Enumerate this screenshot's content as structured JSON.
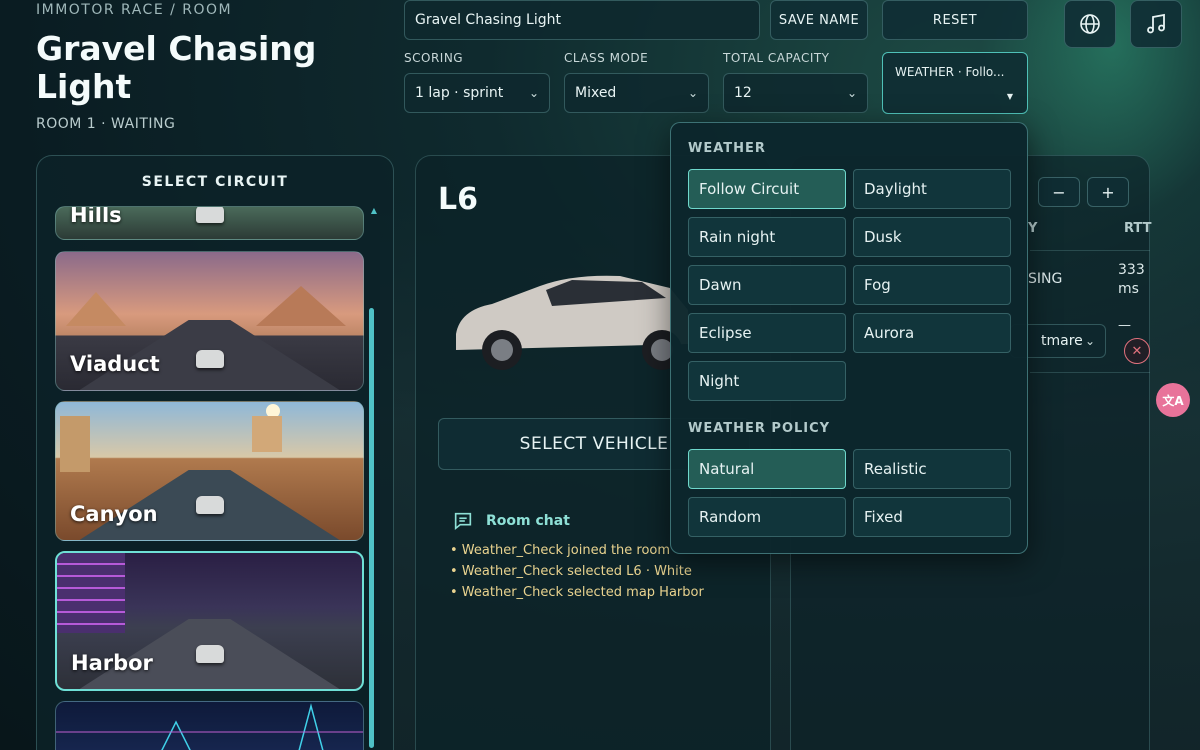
{
  "header": {
    "breadcrumb": "IMMOTOR RACE / ROOM",
    "title": "Gravel Chasing Light",
    "status": "ROOM 1 · WAITING"
  },
  "toolbar": {
    "name_value": "Gravel Chasing Light",
    "save_label": "SAVE NAME",
    "reset_label": "RESET",
    "globe_icon": "globe-icon",
    "music_icon": "music-note-icon"
  },
  "options": {
    "scoring": {
      "label": "SCORING",
      "value": "1 lap · sprint"
    },
    "class_mode": {
      "label": "CLASS MODE",
      "value": "Mixed"
    },
    "capacity": {
      "label": "TOTAL CAPACITY",
      "value": "12"
    },
    "weather": {
      "value": "WEATHER · Follo..."
    }
  },
  "circuit": {
    "heading": "SELECT CIRCUIT",
    "cards": [
      {
        "label": "Hills"
      },
      {
        "label": "Viaduct"
      },
      {
        "label": "Canyon"
      },
      {
        "label": "Harbor",
        "selected": true
      },
      {
        "label": ""
      }
    ]
  },
  "vehicle": {
    "name": "L6",
    "select_label": "SELECT VEHICLE"
  },
  "chat": {
    "title": "Room chat",
    "lines": [
      "• Weather_Check joined the room",
      "• Weather_Check selected L6 · White",
      "• Weather_Check selected map Harbor"
    ]
  },
  "players": {
    "col_y": "Y",
    "col_rtt": "RTT",
    "row_status": "SING",
    "row_rtt_value": "333",
    "row_rtt_unit": "ms",
    "row_select": "tmare",
    "row_dash": "—",
    "minus_label": "−",
    "plus_label": "+"
  },
  "weather_popup": {
    "weather_heading": "WEATHER",
    "weather_options": [
      "Follow Circuit",
      "Daylight",
      "Rain night",
      "Dusk",
      "Dawn",
      "Fog",
      "Eclipse",
      "Aurora",
      "Night"
    ],
    "weather_selected": "Follow Circuit",
    "policy_heading": "WEATHER POLICY",
    "policy_options": [
      "Natural",
      "Realistic",
      "Random",
      "Fixed"
    ],
    "policy_selected": "Natural"
  },
  "colors": {
    "accent": "#4fc1b8",
    "chat_text": "#e9d38f",
    "chat_title": "#8ee0d6",
    "remove": "#e0717d",
    "translate_badge": "#e8739a"
  }
}
